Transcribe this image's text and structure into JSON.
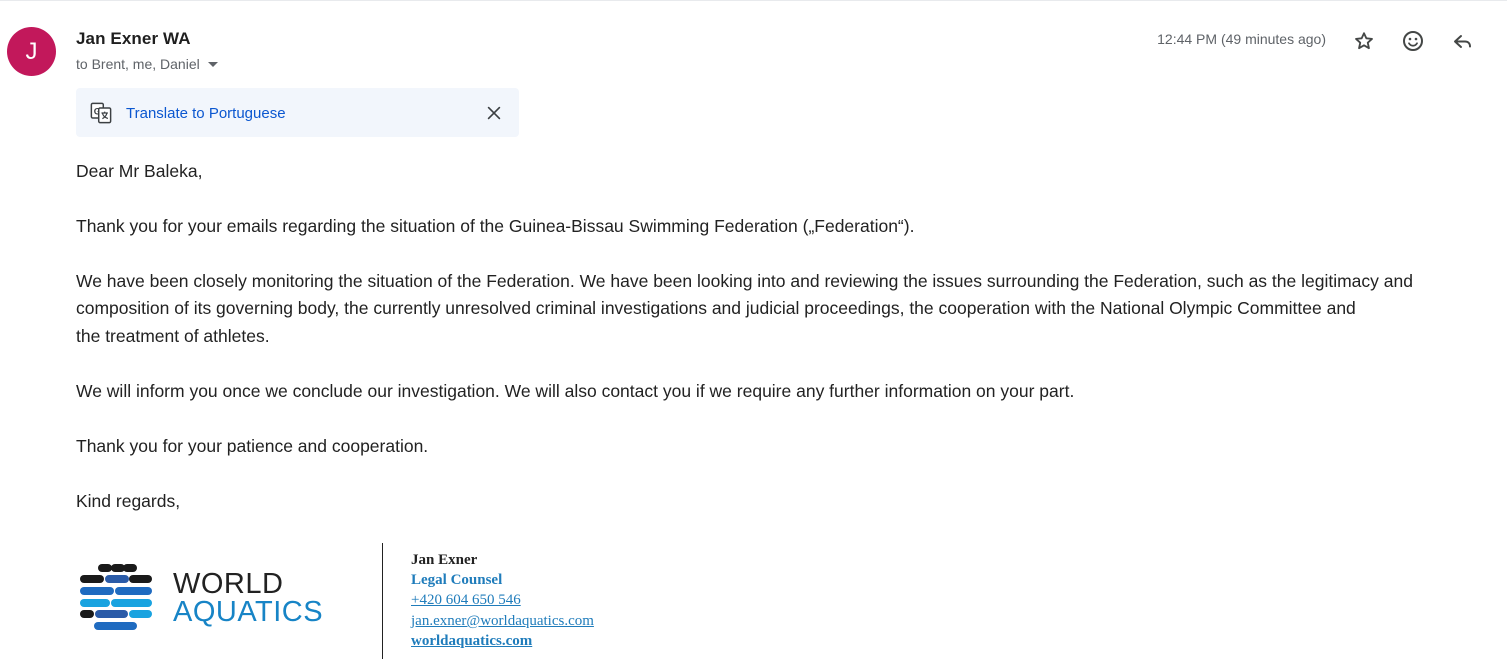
{
  "message": {
    "sender": {
      "initial": "J",
      "name": "Jan Exner WA",
      "avatar_color": "#c2185b"
    },
    "recipients": "to Brent, me, Daniel",
    "timestamp": "12:44 PM (49 minutes ago)",
    "actions": {
      "star": "star-icon",
      "react": "emoji-icon",
      "reply": "reply-icon"
    },
    "translate_bar": {
      "link": "Translate to Portuguese",
      "icon": "translate-icon",
      "close": "close-icon"
    },
    "body": [
      "Dear Mr Baleka,",
      "Thank you for your emails regarding the situation of the Guinea-Bissau Swimming Federation („Federation“).",
      "We have been closely monitoring the situation of the Federation. We have been looking into and reviewing the issues surrounding the Federation, such as the legitimacy and",
      "composition of its governing body, the currently unresolved criminal investigations and judicial proceedings, the cooperation with the National Olympic Committee and",
      "the treatment of athletes.",
      "We will inform you once we conclude our investigation. We will also contact you if we require any further information on your part.",
      "Thank you for your patience and cooperation.",
      "Kind regards,"
    ],
    "signature": {
      "logo_line1": "WORLD",
      "logo_line2": "AQUATICS",
      "name": "Jan Exner",
      "title": "Legal Counsel",
      "phone": "+420 604 650 546",
      "email": "jan.exner@worldaquatics.com",
      "website": "worldaquatics.com"
    }
  },
  "colors": {
    "link_blue": "#0b57d0",
    "signature_blue": "#1f7cbb",
    "logo_blue": "#1784c6",
    "translate_bg": "#f2f6fc"
  }
}
